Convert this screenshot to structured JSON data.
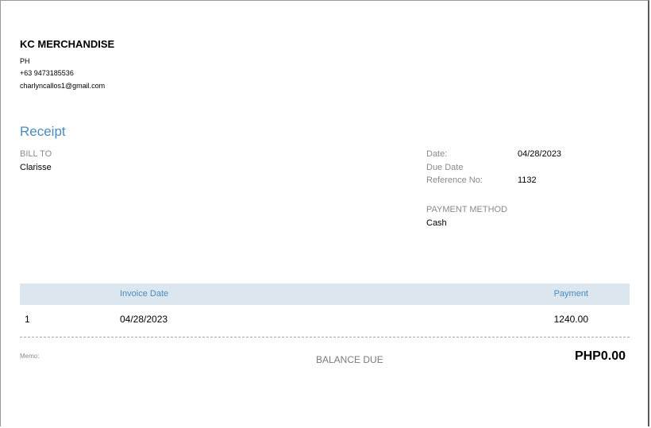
{
  "company": {
    "name": "KC MERCHANDISE",
    "country": "PH",
    "phone": "+63 9473185536",
    "email": "charlyncallos1@gmail.com"
  },
  "document": {
    "title": "Receipt"
  },
  "bill_to": {
    "label": "BILL TO",
    "name": "Clarisse"
  },
  "details": {
    "date_label": "Date:",
    "date_value": "04/28/2023",
    "due_date_label": "Due Date",
    "reference_label": "Reference No:",
    "reference_value": "1132"
  },
  "payment_method": {
    "label": "PAYMENT METHOD",
    "value": "Cash"
  },
  "table": {
    "headers": [
      "",
      "Invoice Date",
      "Payment"
    ],
    "rows": [
      {
        "number": "1",
        "invoice_date": "04/28/2023",
        "payment": "1240.00"
      }
    ]
  },
  "footer": {
    "memo_label": "Memo:",
    "balance_label": "BALANCE DUE",
    "balance_value": "PHP0.00"
  },
  "colors": {
    "accent": "#4a8bbd",
    "table_header_bg": "#dbe6ef"
  }
}
